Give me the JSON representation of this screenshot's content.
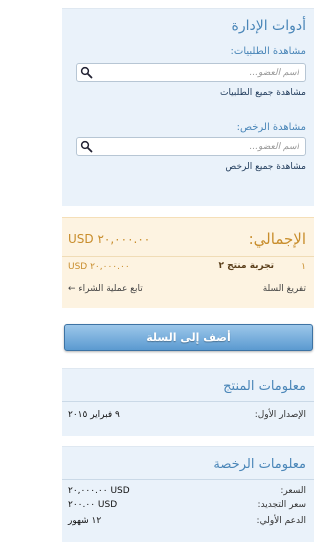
{
  "admin": {
    "title": "أدوات الإدارة",
    "orders_label": "مشاهدة الطلبيات:",
    "orders_placeholder": "اسم العضو...",
    "orders_view_all": "مشاهدة جميع الطلبيات",
    "licenses_label": "مشاهدة الرخص:",
    "licenses_placeholder": "اسم العضو...",
    "licenses_view_all": "مشاهدة جميع الرخص"
  },
  "cart": {
    "total_label": "الإجمالي:",
    "total_value": "USD ٢٠,٠٠٠.٠٠",
    "items": [
      {
        "index": "١",
        "name": "تجربة منتج ٢",
        "price": "USD ٢٠,٠٠٠.٠٠"
      }
    ],
    "empty_label": "تفريغ السلة",
    "checkout_label": "تابع عملية الشراء ←"
  },
  "add_to_cart_label": "أضف إلى السلة",
  "product_info": {
    "title": "معلومات المنتج",
    "release_label": "الإصدار الأول:",
    "release_value": "٩ فبراير ٢٠١٥"
  },
  "license_info": {
    "title": "معلومات الرخصة",
    "price_label": "السعر:",
    "price_value": "USD ٢٠,٠٠٠.٠٠",
    "renewal_label": "سعر التجديد:",
    "renewal_value": "USD ٢٠٠.٠٠",
    "support_label": "الدعم الأولي:",
    "support_value": "١٢ شهور"
  },
  "colors": {
    "accent": "#4a86b8",
    "cart_accent": "#c88d2c",
    "panel_bg": "#eaf2fa",
    "cart_bg": "#fdf3e1"
  },
  "icons": {
    "search": "search-icon"
  }
}
